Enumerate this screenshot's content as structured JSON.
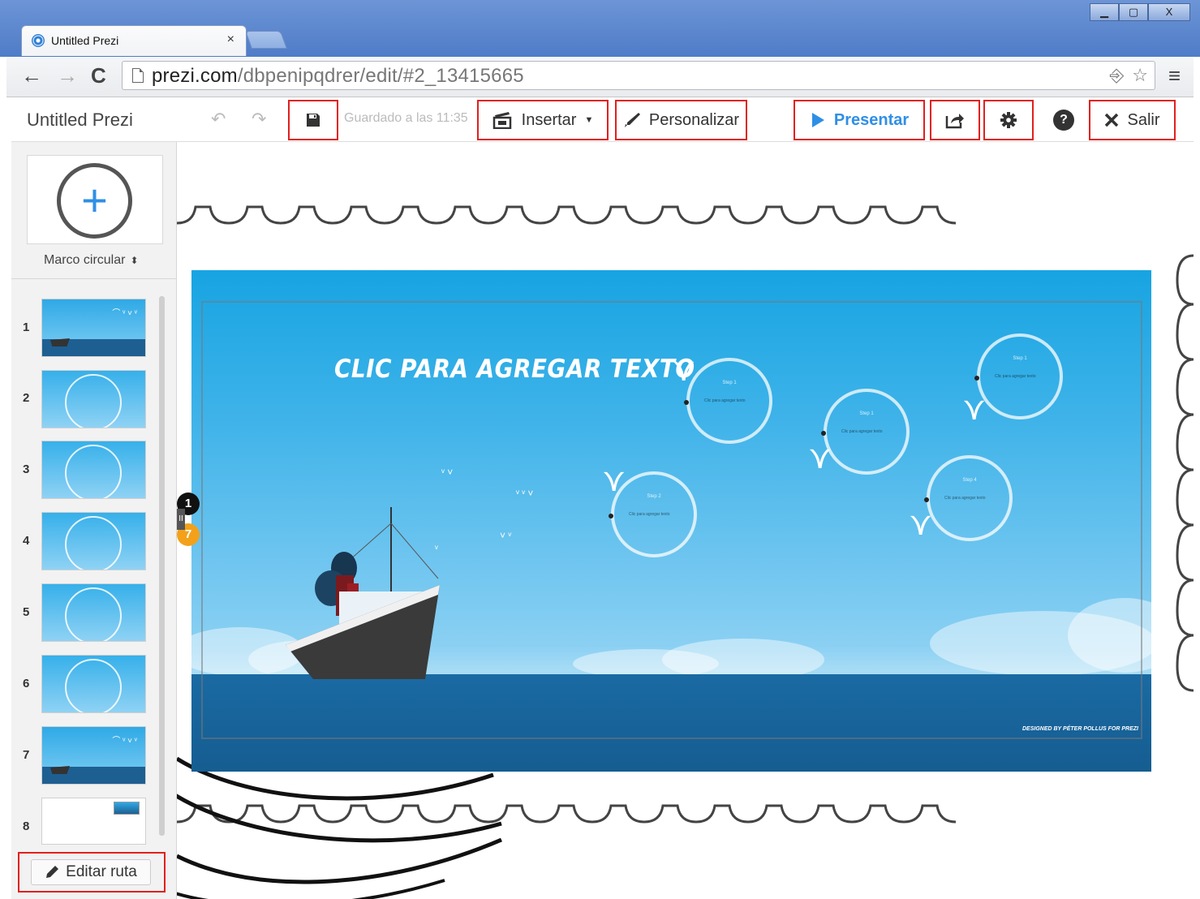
{
  "browser": {
    "tab_title": "Untitled Prezi",
    "tab_close": "×",
    "url_host": "prezi.com",
    "url_path": "/dbpenipqdrer/edit/#2_13415665",
    "nav": {
      "back": "←",
      "forward": "→",
      "reload": "C"
    },
    "omni_icons": {
      "translate": "⎆",
      "star": "☆"
    },
    "menu": "≡",
    "window_buttons": {
      "minimize": "▁",
      "maximize": "▢",
      "close": "X"
    }
  },
  "appbar": {
    "doc_title": "Untitled Prezi",
    "undo": "↶",
    "redo": "↷",
    "saved_text": "Guardado a las 11:35",
    "insert_label": "Insertar",
    "customize_label": "Personalizar",
    "present_label": "Presentar",
    "exit_label": "Salir",
    "help": "?"
  },
  "sidebar": {
    "frame_type": "Marco circular",
    "add_plus": "+",
    "thumbnails": [
      "1",
      "2",
      "3",
      "4",
      "5",
      "6",
      "7",
      "8"
    ],
    "edit_path_label": "Editar ruta"
  },
  "canvas": {
    "slide_title": "CLIC PARA AGREGAR TEXTO",
    "credit": "DESIGNED BY PÉTER POLLUS FOR PREZI",
    "circles": [
      {
        "step": "Step 1",
        "text": "Clic para agregar texto"
      },
      {
        "step": "Step 1",
        "text": "Clic para agregar texto"
      },
      {
        "step": "Step 1",
        "text": "Clic para agregar texto"
      },
      {
        "step": "Step 2",
        "text": "Clic para agregar texto"
      },
      {
        "step": "Step 4",
        "text": "Clic para agregar texto"
      }
    ],
    "path_badge_first": "1",
    "path_badge_last": "7",
    "path_handle": "II"
  },
  "colors": {
    "highlight": "#e1201e",
    "accent_blue": "#2f8fe6",
    "path_orange": "#f3a11b"
  }
}
